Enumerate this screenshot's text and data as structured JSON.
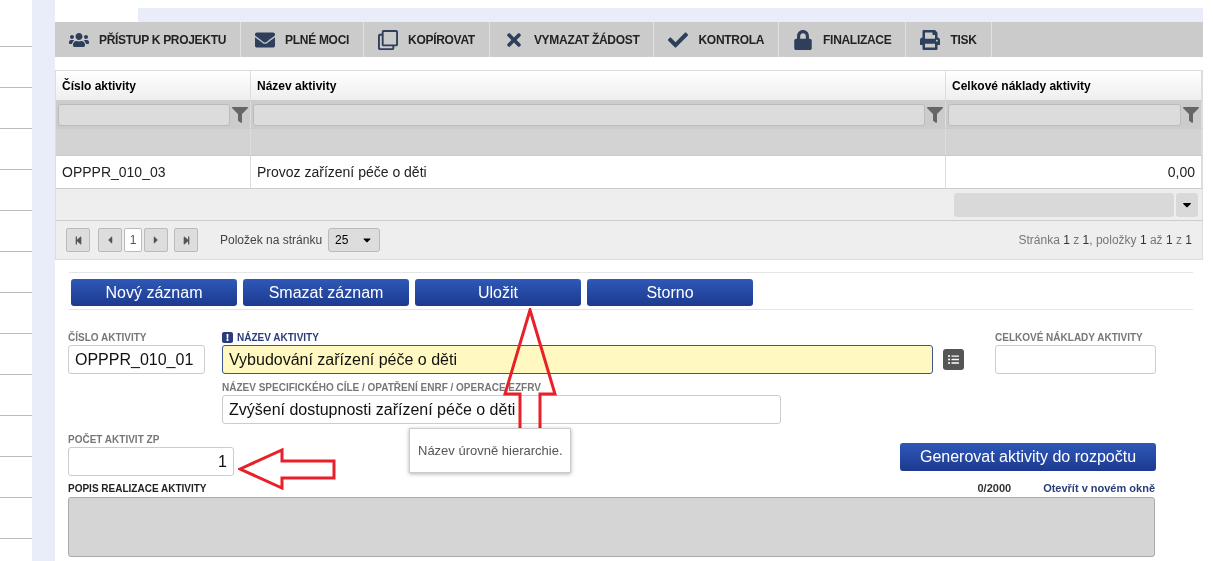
{
  "toolbar": [
    {
      "kind": "users",
      "label": "PŘÍSTUP K PROJEKTU"
    },
    {
      "kind": "mail",
      "label": "PLNÉ MOCI"
    },
    {
      "kind": "copy",
      "label": "KOPÍROVAT"
    },
    {
      "kind": "delete",
      "label": "VYMAZAT ŽÁDOST"
    },
    {
      "kind": "check",
      "label": "KONTROLA"
    },
    {
      "kind": "lock",
      "label": "FINALIZACE"
    },
    {
      "kind": "print",
      "label": "TISK"
    }
  ],
  "table": {
    "columns": [
      "Číslo aktivity",
      "Název aktivity",
      "Celkové náklady aktivity"
    ],
    "rows": [
      [
        "OPPPR_010_03",
        "Provoz zařízení péče o děti",
        "0,00"
      ]
    ]
  },
  "pager": {
    "page": "1",
    "per_page_label": "Položek na stránku",
    "per_page": "25",
    "summary": "Stránka **1** z **1**, položky **1** až **1** z **1**"
  },
  "actions": [
    "Nový záznam",
    "Smazat záznam",
    "Uložit",
    "Storno"
  ],
  "form": {
    "number": {
      "label": "ČÍSLO AKTIVITY",
      "value": "OPPPR_010_01"
    },
    "name": {
      "label": "NÁZEV AKTIVITY",
      "value": "Vybudování zařízení péče o děti",
      "required": true,
      "focused": true
    },
    "cost": {
      "label": "CELKOVÉ NÁKLADY AKTIVITY"
    },
    "goal": {
      "label": "NÁZEV SPECIFICKÉHO CÍLE / OPATŘENÍ ENRF / OPERACE EZFRV",
      "value": "Zvýšení dostupnosti zařízení péče o děti"
    },
    "count": {
      "label": "POČET AKTIVIT ZP",
      "value": "1"
    },
    "tooltip": "Název úrovně hierarchie.",
    "generate_button": "Generovat aktivity do rozpočtu",
    "description": {
      "label": "POPIS REALIZACE AKTIVITY",
      "counter": "0/2000",
      "link": "Otevřít v novém okně",
      "disabled": true
    }
  }
}
